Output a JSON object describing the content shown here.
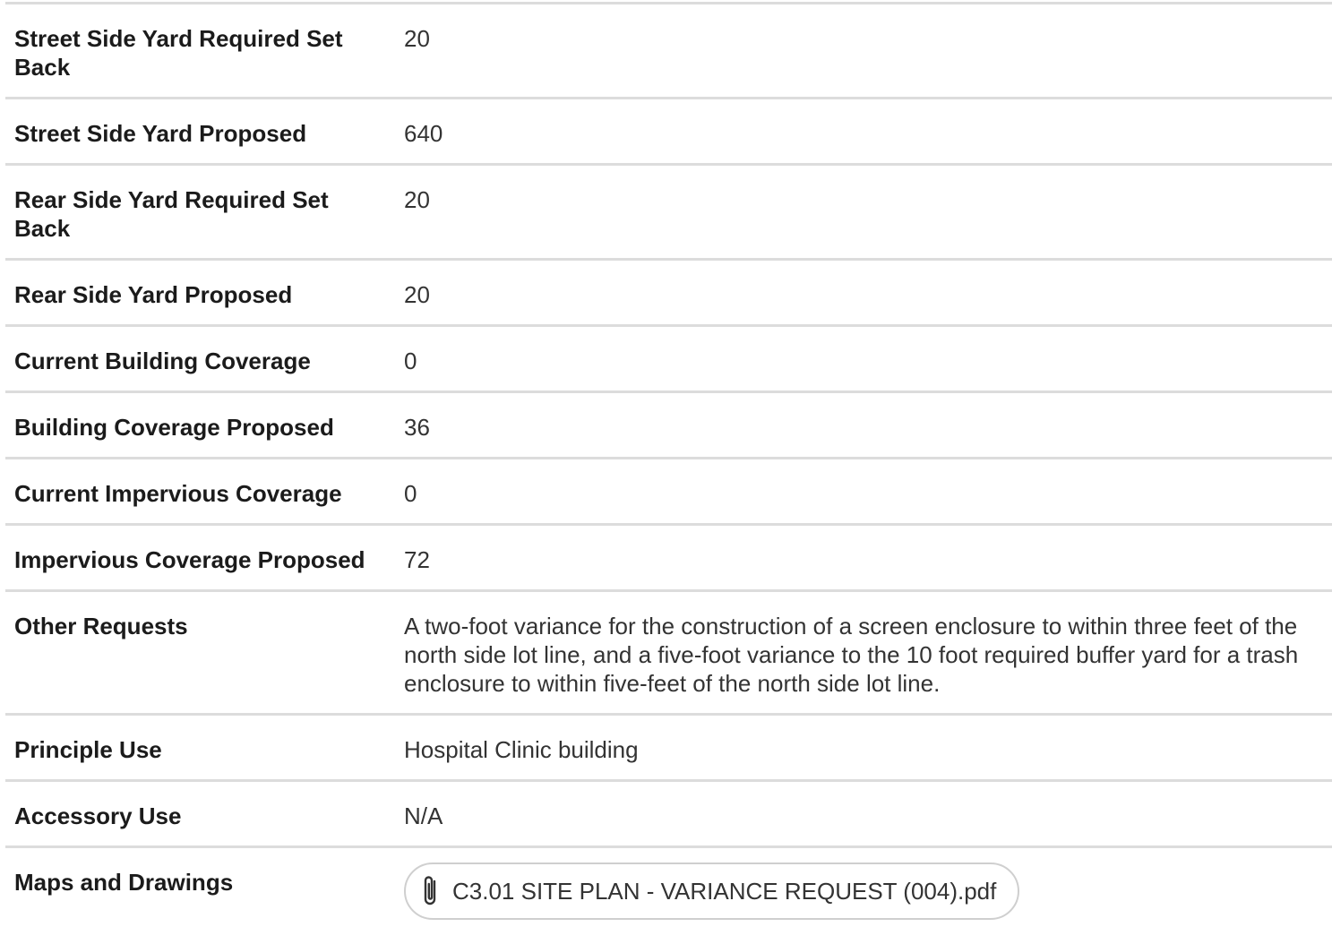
{
  "rows": [
    {
      "label": "Street Side Yard Required Set Back",
      "value": "20"
    },
    {
      "label": "Street Side Yard Proposed",
      "value": "640"
    },
    {
      "label": "Rear Side Yard Required Set Back",
      "value": "20"
    },
    {
      "label": "Rear Side Yard Proposed",
      "value": "20"
    },
    {
      "label": "Current Building Coverage",
      "value": "0"
    },
    {
      "label": "Building Coverage Proposed",
      "value": "36"
    },
    {
      "label": "Current Impervious Coverage",
      "value": "0"
    },
    {
      "label": "Impervious Coverage Proposed",
      "value": "72"
    },
    {
      "label": "Other Requests",
      "value": "A two-foot variance for the construction of a screen enclosure to within three feet of the north side lot line, and a five-foot variance to the 10 foot required buffer yard for a trash enclosure to within five-feet of the north side lot line."
    },
    {
      "label": "Principle Use",
      "value": "Hospital Clinic building"
    },
    {
      "label": "Accessory Use",
      "value": "N/A"
    },
    {
      "label": "Maps and Drawings",
      "attachment": "C3.01 SITE PLAN - VARIANCE REQUEST (004).pdf",
      "attachment_icon": "paperclip-icon"
    }
  ]
}
